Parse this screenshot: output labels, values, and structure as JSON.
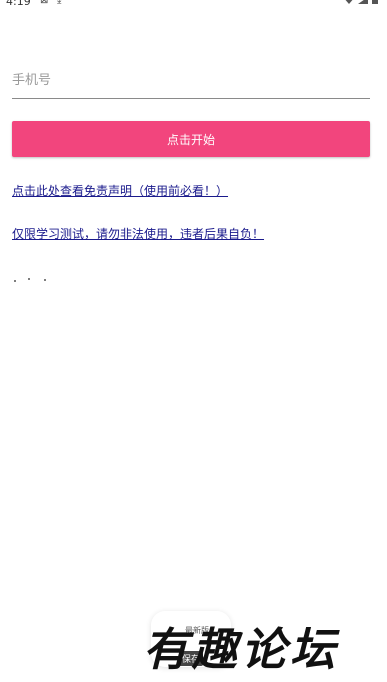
{
  "status_bar": {
    "time": "4:19",
    "notification_icons": [
      "notification-icon",
      "download-icon"
    ],
    "right_icons": [
      "wifi-icon",
      "signal-icon",
      "battery-icon"
    ]
  },
  "form": {
    "phone_placeholder": "手机号",
    "phone_value": "",
    "start_button_label": "点击开始"
  },
  "links": {
    "disclaimer": "点击此处查看免责声明（使用前必看！）",
    "warning": "仅限学习测试，请勿非法使用，违者后果自负！"
  },
  "toast": {
    "title": "最新版",
    "save_label": "保存"
  },
  "watermark": {
    "text": "有趣论坛"
  },
  "colors": {
    "accent": "#f2457d",
    "link": "#1a1a8c",
    "divider": "#8a8a8a"
  }
}
